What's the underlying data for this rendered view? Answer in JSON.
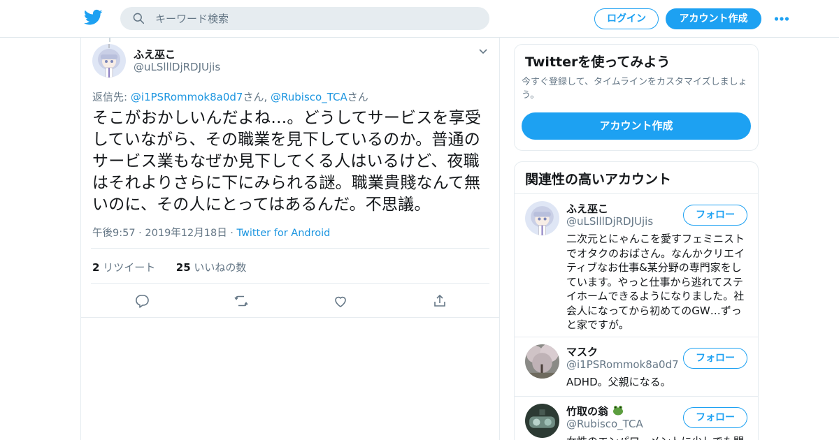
{
  "header": {
    "search_placeholder": "キーワード検索",
    "login_label": "ログイン",
    "signup_label": "アカウント作成"
  },
  "colors": {
    "brand": "#1da1f2",
    "link": "#1b95e0",
    "muted": "#657786"
  },
  "tweet": {
    "author_name": "ふえ巫こ",
    "author_handle": "@uLSlllDjRDJUjis",
    "reply_prefix": "返信先: ",
    "reply_user1": "@i1PSRommok8a0d7",
    "reply_san1": "さん, ",
    "reply_user2": "@Rubisco_TCA",
    "reply_san2": "さん",
    "text": "そこがおかしいんだよね…。どうしてサービスを享受していながら、その職業を見下しているのか。普通のサービス業もなぜか見下してくる人はいるけど、夜職はそれよりさらに下にみられる謎。職業貴賤なんて無いのに、その人にとってはあるんだ。不思議。",
    "timestamp": "午後9:57 · 2019年12月18日 · ",
    "source": "Twitter for Android",
    "retweets_count": "2",
    "retweets_label": " リツイート",
    "likes_count": "25",
    "likes_label": " いいねの数"
  },
  "sidebar": {
    "signup_card": {
      "title": "Twitterを使ってみよう",
      "description": "今すぐ登録して、タイムラインをカスタマイズしましょう。",
      "button_label": "アカウント作成"
    },
    "related": {
      "title": "関連性の高いアカウント",
      "follow_label": "フォロー",
      "accounts": [
        {
          "name": "ふえ巫こ",
          "handle": "@uLSlllDjRDJUjis",
          "bio": "二次元とにゃんこを愛すフェミニストでオタクのおばさん。なんかクリエイティブなお仕事&某分野の専門家をしています。やっと仕事から逃れてステイホームできるようになりました。社会人になってから初めてのGW…ずっと家ですが。"
        },
        {
          "name": "マスク",
          "handle": "@i1PSRommok8a0d7",
          "bio": "ADHD。父親になる。"
        },
        {
          "name": "竹取の翁",
          "handle": "@Rubisco_TCA",
          "bio": "女性のエンパワーメントに少しでも関"
        }
      ]
    }
  }
}
